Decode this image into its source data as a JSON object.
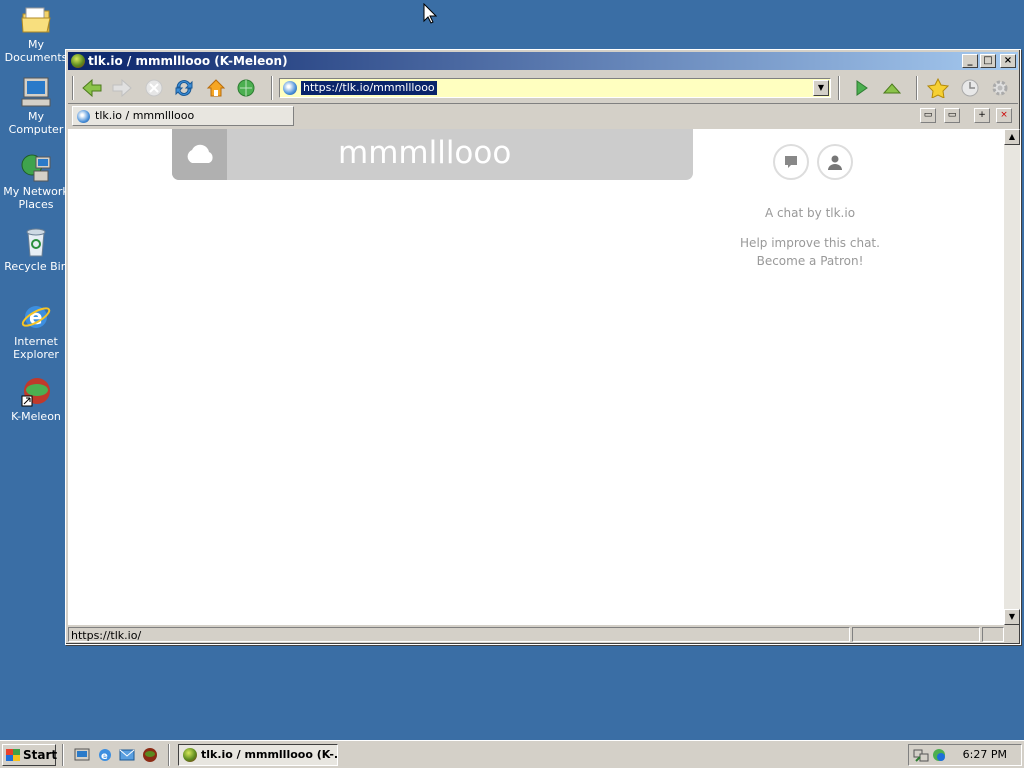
{
  "desktop": {
    "icons": [
      {
        "label": "My Documents",
        "icon": "folder-icon"
      },
      {
        "label": "My Computer",
        "icon": "computer-icon"
      },
      {
        "label": "My Network Places",
        "icon": "network-icon"
      },
      {
        "label": "Recycle Bin",
        "icon": "recycle-bin-icon"
      },
      {
        "label": "Internet Explorer",
        "icon": "ie-icon"
      },
      {
        "label": "K-Meleon",
        "icon": "kmeleon-icon"
      }
    ]
  },
  "window": {
    "title": "tlk.io / mmmlllooo (K-Meleon)",
    "buttons": {
      "minimize": "_",
      "maximize": "□",
      "close": "×"
    }
  },
  "toolbar": {
    "url": "https://tlk.io/mmmlllooo"
  },
  "tabs": [
    {
      "label": "tlk.io / mmmlllooo"
    }
  ],
  "page": {
    "room_name": "mmmlllooo",
    "chat_by": "A chat by tlk.io",
    "help_line1": "Help improve this chat.",
    "help_line2": "Become a Patron!"
  },
  "statusbar": {
    "text": "https://tlk.io/"
  },
  "taskbar": {
    "start_label": "Start",
    "task_label": "tlk.io / mmmlllooo (K-...",
    "clock": "6:27 PM"
  },
  "colors": {
    "desktop": "#3a6ea5",
    "titlebar_start": "#0a246a",
    "titlebar_end": "#a6caf0",
    "url_bg": "#ffffc0",
    "header_bg": "#cccccc"
  }
}
